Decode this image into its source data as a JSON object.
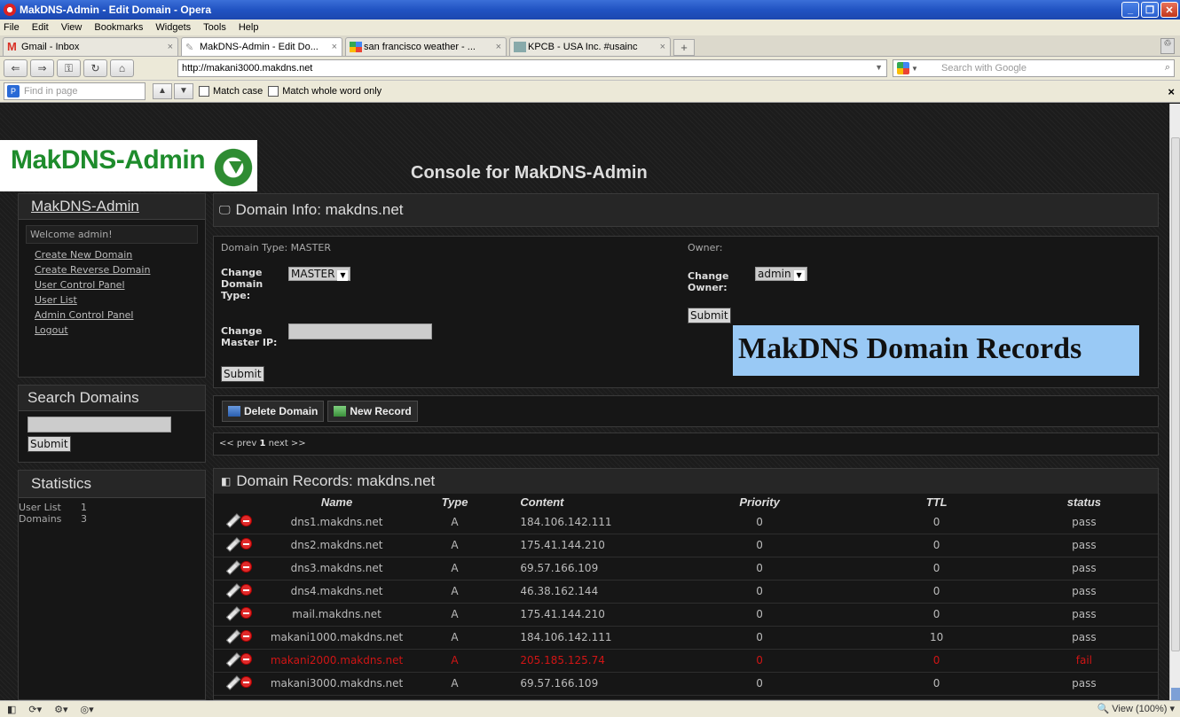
{
  "window": {
    "title": "MakDNS-Admin - Edit Domain - Opera",
    "buttons": [
      "_",
      "❐",
      "✕"
    ]
  },
  "menu": [
    "File",
    "Edit",
    "View",
    "Bookmarks",
    "Widgets",
    "Tools",
    "Help"
  ],
  "tabs": [
    {
      "label": "Gmail - Inbox",
      "close": "×"
    },
    {
      "label": "MakDNS-Admin - Edit Do...",
      "close": "×"
    },
    {
      "label": "san francisco weather - ...",
      "close": "×"
    },
    {
      "label": "KPCB - USA Inc. #usainc",
      "close": "×"
    }
  ],
  "address": {
    "url": "http://makani3000.makdns.net",
    "search_placeholder": "Search with Google"
  },
  "findbar": {
    "placeholder": "Find in page",
    "match_case": "Match case",
    "match_whole_word": "Match whole word only"
  },
  "header": {
    "logo_text": "MakDNS-Admin",
    "console_title": "Console for MakDNS-Admin"
  },
  "sidebar": {
    "title": "MakDNS-Admin",
    "welcome": "Welcome admin!",
    "links": [
      "Create New Domain",
      "Create Reverse Domain",
      "User Control Panel",
      "User List",
      "Admin Control Panel",
      "Logout"
    ],
    "search_title": "Search Domains",
    "search_submit": "Submit",
    "stats_title": "Statistics",
    "stats": [
      {
        "label": "User List",
        "value": "1"
      },
      {
        "label": "Domains",
        "value": "3"
      }
    ]
  },
  "domain_info": {
    "title": "Domain Info: makdns.net",
    "domain_type_label": "Domain Type: MASTER",
    "change_type_label_1": "Change",
    "change_type_label_2": "Domain",
    "change_type_label_3": "Type:",
    "type_value": "MASTER",
    "change_master_ip_1": "Change",
    "change_master_ip_2": "Master IP:",
    "submit": "Submit",
    "owner_label": "Owner:",
    "change_owner_1": "Change",
    "change_owner_2": "Owner:",
    "owner_value": "admin",
    "owner_submit": "Submit"
  },
  "overlay_title": "MakDNS Domain Records",
  "actions": {
    "delete_domain": "Delete Domain",
    "new_record": "New Record"
  },
  "pager": {
    "prev": "<< prev",
    "current": "1",
    "next": "next >>"
  },
  "records": {
    "title": "Domain Records: makdns.net",
    "columns": [
      "Name",
      "Type",
      "Content",
      "Priority",
      "TTL",
      "status"
    ],
    "rows": [
      {
        "name": "dns1.makdns.net",
        "type": "A",
        "content": "184.106.142.111",
        "priority": "0",
        "ttl": "0",
        "status": "pass",
        "fail": false
      },
      {
        "name": "dns2.makdns.net",
        "type": "A",
        "content": "175.41.144.210",
        "priority": "0",
        "ttl": "0",
        "status": "pass",
        "fail": false
      },
      {
        "name": "dns3.makdns.net",
        "type": "A",
        "content": "69.57.166.109",
        "priority": "0",
        "ttl": "0",
        "status": "pass",
        "fail": false
      },
      {
        "name": "dns4.makdns.net",
        "type": "A",
        "content": "46.38.162.144",
        "priority": "0",
        "ttl": "0",
        "status": "pass",
        "fail": false
      },
      {
        "name": "mail.makdns.net",
        "type": "A",
        "content": "175.41.144.210",
        "priority": "0",
        "ttl": "0",
        "status": "pass",
        "fail": false
      },
      {
        "name": "makani1000.makdns.net",
        "type": "A",
        "content": "184.106.142.111",
        "priority": "0",
        "ttl": "10",
        "status": "pass",
        "fail": false
      },
      {
        "name": "makani2000.makdns.net",
        "type": "A",
        "content": "205.185.125.74",
        "priority": "0",
        "ttl": "0",
        "status": "fail",
        "fail": true
      },
      {
        "name": "makani3000.makdns.net",
        "type": "A",
        "content": "69.57.166.109",
        "priority": "0",
        "ttl": "0",
        "status": "pass",
        "fail": false
      }
    ]
  },
  "statusbar": {
    "zoom": "View (100%)"
  },
  "colors": {
    "fail_red": "#d01515",
    "logo_green": "#1e8c2c",
    "overlay_blue": "#99c9f5"
  }
}
